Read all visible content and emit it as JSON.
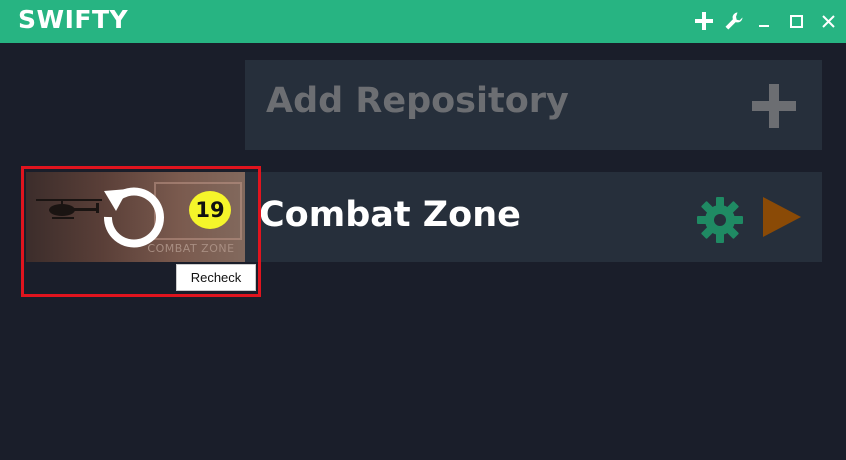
{
  "app": {
    "title": "SWIFTY"
  },
  "titlebar": {
    "buttons": [
      {
        "name": "add-icon"
      },
      {
        "name": "wrench-icon"
      },
      {
        "name": "minimize-icon"
      },
      {
        "name": "maximize-icon"
      },
      {
        "name": "close-icon"
      }
    ]
  },
  "add_repository": {
    "label": "Add Repository"
  },
  "repositories": [
    {
      "name": "Combat Zone",
      "thumbnail_caption": "COMBAT ZONE",
      "badge_count": "19",
      "tooltip": "Recheck"
    }
  ],
  "colors": {
    "titlebar": "#27b482",
    "background": "#1a1e2a",
    "panel": "#262f3b",
    "gear": "#1f8a63",
    "play": "#8a4a06",
    "badge": "#f5f52a",
    "highlight": "#e0141e"
  }
}
